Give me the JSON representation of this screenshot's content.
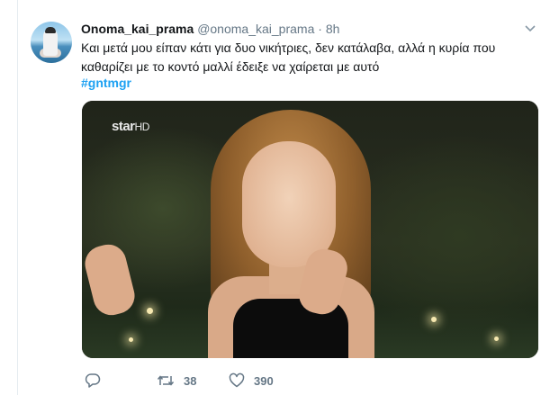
{
  "tweet": {
    "display_name": "Onoma_kai_prama",
    "handle": "@onoma_kai_prama",
    "separator": "·",
    "time": "8h",
    "text": "Και μετά μου είπαν κάτι για δυο νικήτριες, δεν κατάλαβα, αλλά η κυρία που καθαρίζει με το κοντό μαλλί έδειξε να χαίρεται με αυτό",
    "hashtag": "#gntmgr"
  },
  "media": {
    "channel_logo": "star",
    "channel_logo_suffix": "HD"
  },
  "actions": {
    "reply_icon": "reply-icon",
    "retweet_icon": "retweet-icon",
    "retweet_count": "38",
    "like_icon": "heart-icon",
    "like_count": "390"
  },
  "colors": {
    "link": "#1da1f2",
    "muted": "#657786",
    "text": "#14171a"
  }
}
